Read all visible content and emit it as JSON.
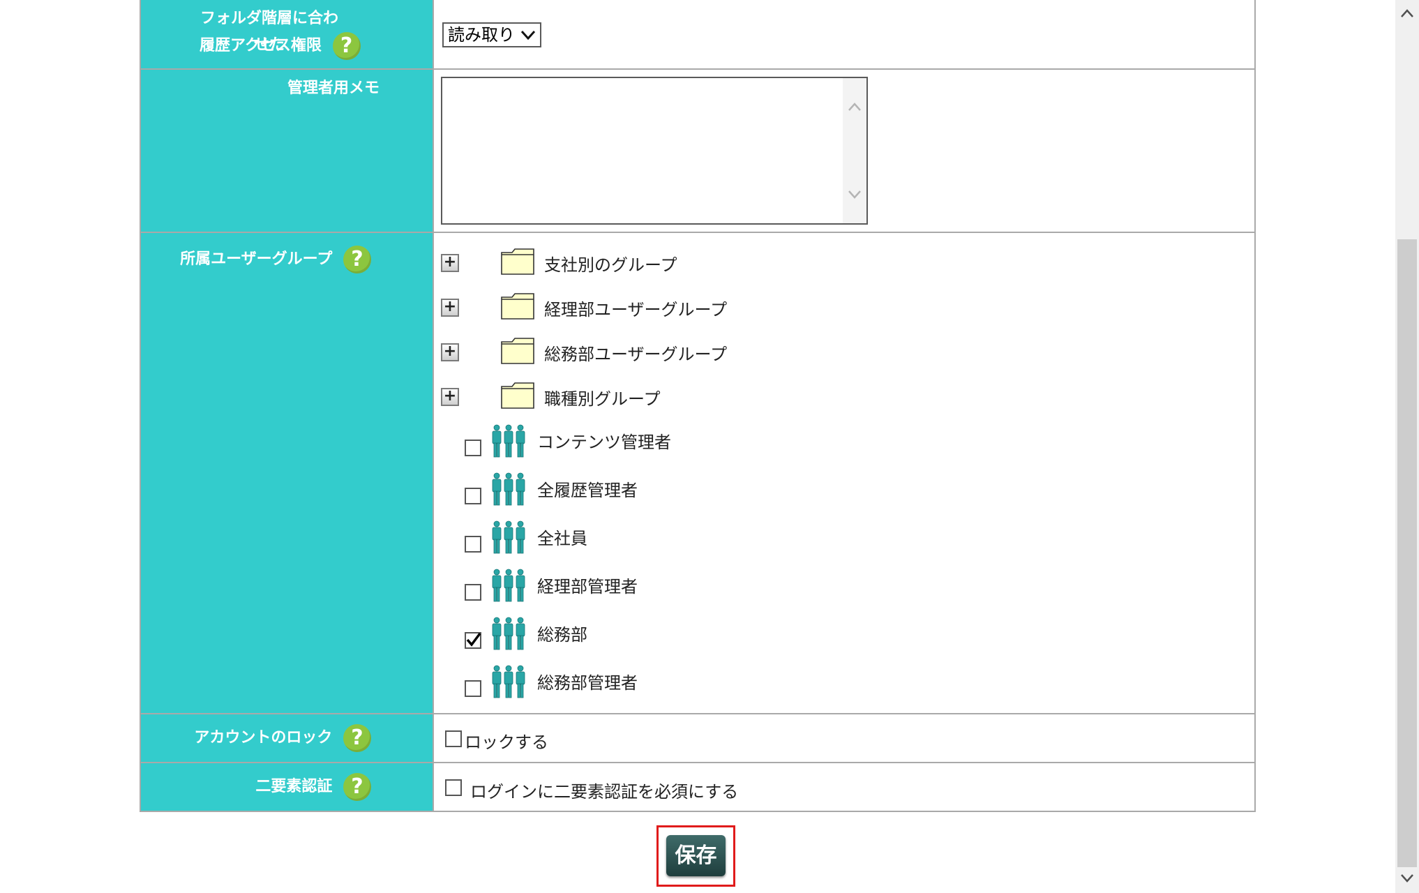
{
  "rows": {
    "history_access": {
      "label_line1": "フォルダ階層に合わせた",
      "label_line2": "履歴アクセス権限",
      "select_value": "読み取り"
    },
    "admin_memo": {
      "label": "管理者用メモ",
      "value": ""
    },
    "user_groups": {
      "label": "所属ユーザーグループ",
      "folders": [
        {
          "name": "支社別のグループ"
        },
        {
          "name": "経理部ユーザーグループ"
        },
        {
          "name": "総務部ユーザーグループ"
        },
        {
          "name": "職種別グループ"
        }
      ],
      "groups": [
        {
          "name": "コンテンツ管理者",
          "checked": false
        },
        {
          "name": "全履歴管理者",
          "checked": false
        },
        {
          "name": "全社員",
          "checked": false
        },
        {
          "name": "経理部管理者",
          "checked": false
        },
        {
          "name": "総務部",
          "checked": true
        },
        {
          "name": "総務部管理者",
          "checked": false
        }
      ]
    },
    "account_lock": {
      "label": "アカウントのロック",
      "checkbox_label": "ロックする",
      "checked": false
    },
    "two_factor": {
      "label": "二要素認証",
      "checkbox_label": "ログインに二要素認証を必須にする",
      "checked": false
    }
  },
  "help_glyph": "?",
  "save_label": "保存",
  "icons": {
    "help": "question-circle-icon",
    "folder": "folder-icon",
    "group": "people-group-icon",
    "expand": "plus-box-icon"
  },
  "colors": {
    "label_bg": "#33cccc",
    "help_bg": "#8cc63f",
    "save_bg": "#2e5553",
    "highlight": "#e01b1b"
  }
}
